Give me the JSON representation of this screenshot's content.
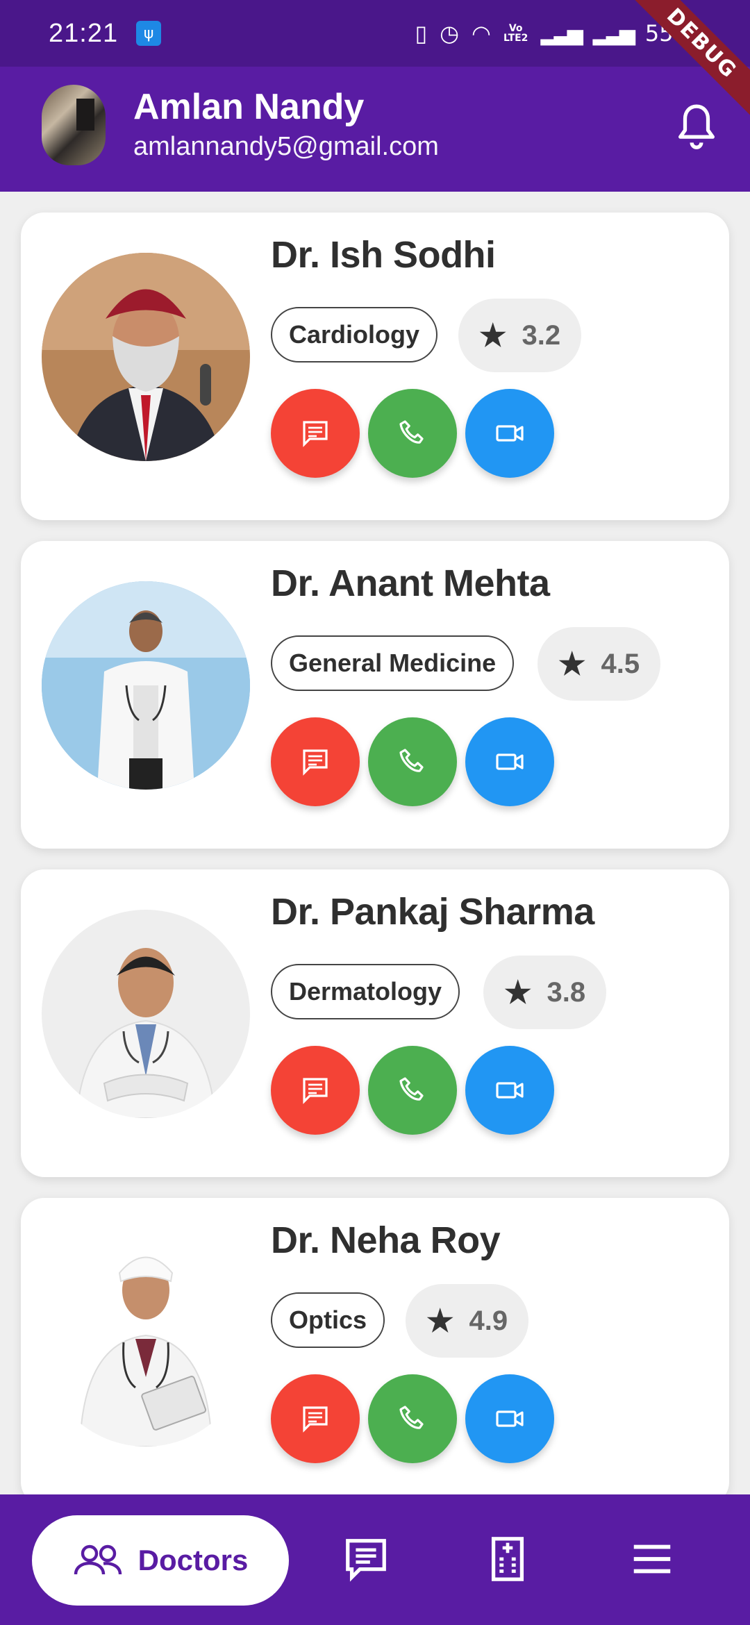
{
  "status_bar": {
    "time": "21:21",
    "battery": "55%",
    "debug_label": "DEBUG",
    "network": "LTE2"
  },
  "header": {
    "user_name": "Amlan Nandy",
    "user_email": "amlannandy5@gmail.com",
    "notification_icon": "bell-icon"
  },
  "doctors": [
    {
      "name": "Dr. Ish Sodhi",
      "specialty": "Cardiology",
      "rating": "3.2"
    },
    {
      "name": "Dr. Anant Mehta",
      "specialty": "General Medicine",
      "rating": "4.5"
    },
    {
      "name": "Dr. Pankaj Sharma",
      "specialty": "Dermatology",
      "rating": "3.8"
    },
    {
      "name": "Dr. Neha Roy",
      "specialty": "Optics",
      "rating": "4.9"
    }
  ],
  "action_colors": {
    "chat": "#f44336",
    "call": "#4caf50",
    "video": "#2196f3"
  },
  "bottom_nav": {
    "active_label": "Doctors",
    "items": [
      "doctors-icon",
      "chat-icon",
      "hospital-icon",
      "menu-icon"
    ]
  },
  "colors": {
    "primary": "#591ca3",
    "status_bar": "#4a178a"
  }
}
